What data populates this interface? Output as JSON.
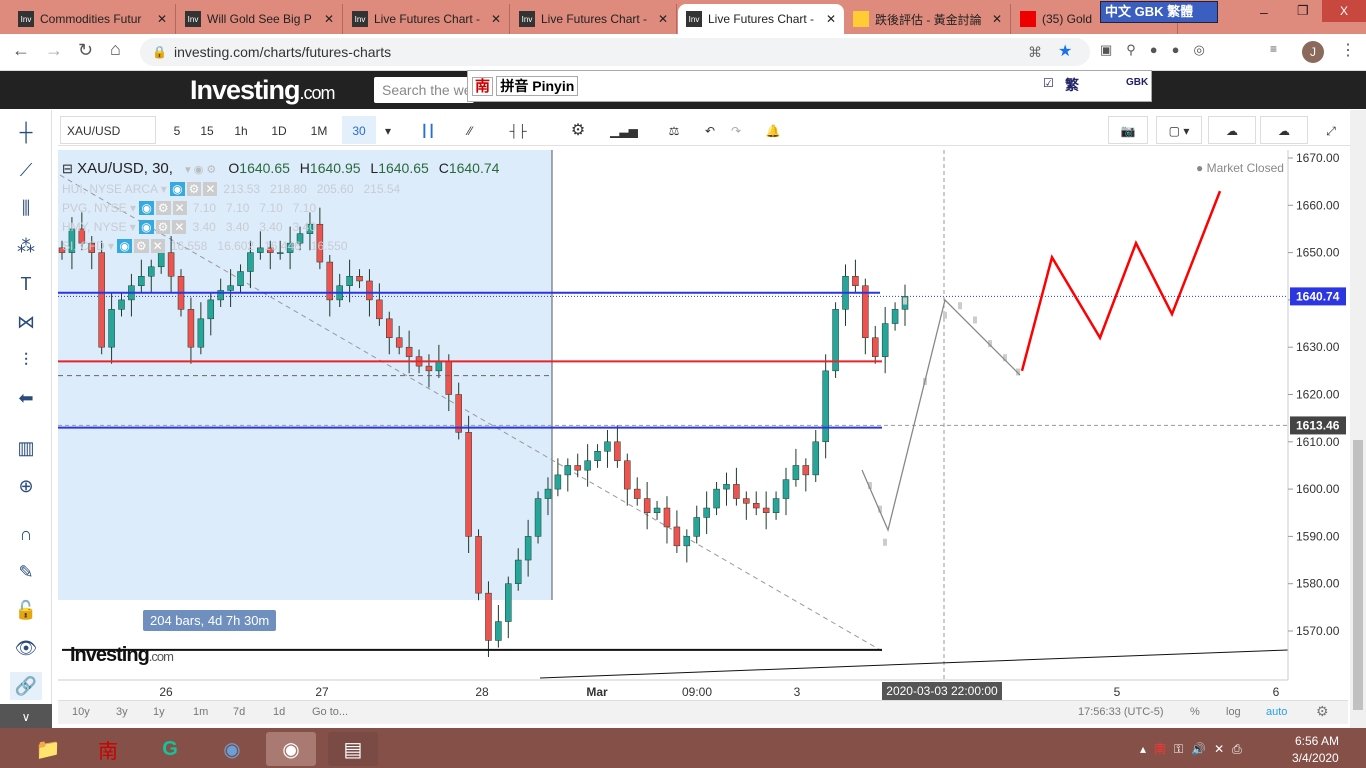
{
  "browser": {
    "tabs": [
      {
        "label": "Commodities Futur",
        "icon": "investing-icon"
      },
      {
        "label": "Will Gold See Big P",
        "icon": "investing-icon"
      },
      {
        "label": "Live Futures Chart -",
        "icon": "investing-icon"
      },
      {
        "label": "Live Futures Chart -",
        "icon": "investing-icon"
      },
      {
        "label": "Live Futures Chart -",
        "icon": "investing-icon",
        "active": true
      },
      {
        "label": "跌後評估 - 黃金討論",
        "icon": "bulb-icon"
      },
      {
        "label": "(35) Gold",
        "icon": "youtube-icon"
      }
    ],
    "url": "investing.com/charts/futures-charts",
    "profile": "J",
    "ime_lang": "中文 GBK 繁體"
  },
  "site": {
    "logo": "Investing",
    "logo_suffix": ".com",
    "search_placeholder": "Search the we"
  },
  "ime": {
    "mode": "拼音 Pinyin",
    "badge": "南",
    "trad": "繁",
    "gbk": "GBK"
  },
  "toolbar": {
    "symbol": "XAU/USD",
    "intervals": [
      "5",
      "15",
      "1h",
      "1D",
      "1M",
      "30"
    ],
    "active_interval": "30"
  },
  "legend": {
    "title": "XAU/USD, 30,",
    "o_label": "O",
    "o": "1640.65",
    "h_label": "H",
    "h": "1640.95",
    "l_label": "L",
    "l": "1640.65",
    "c_label": "C",
    "c": "1640.74",
    "studies": [
      {
        "name": "HUI, NYSE ARCA",
        "values": "213.53   218.80   205.60   215.54"
      },
      {
        "name": "PVG, NYSE",
        "values": "7.10   7.10   7.10   7.10"
      },
      {
        "name": "HMY, NYSE",
        "values": "3.40   3.40   3.40   3.40"
      },
      {
        "name": "SI, CFD",
        "values": "16.558   16.602   16.446   16.550"
      }
    ]
  },
  "chart_data": {
    "type": "candlestick",
    "symbol": "XAU/USD",
    "interval": "30",
    "ylim": [
      1565,
      1672
    ],
    "y_ticks": [
      1670,
      1660,
      1650,
      1640,
      1630,
      1620,
      1610,
      1600,
      1590,
      1580,
      1570
    ],
    "x_ticks": [
      "26",
      "27",
      "28",
      "Mar",
      "09:00",
      "3",
      "5",
      "6"
    ],
    "closes": [
      1650,
      1655,
      1652,
      1650,
      1630,
      1638,
      1640,
      1643,
      1645,
      1647,
      1650,
      1645,
      1638,
      1630,
      1636,
      1640,
      1642,
      1643,
      1646,
      1650,
      1651,
      1650,
      1650,
      1652,
      1654,
      1656,
      1648,
      1640,
      1643,
      1645,
      1644,
      1640,
      1636,
      1632,
      1630,
      1628,
      1626,
      1625,
      1627,
      1620,
      1612,
      1590,
      1578,
      1568,
      1572,
      1580,
      1585,
      1590,
      1598,
      1600,
      1603,
      1605,
      1604,
      1606,
      1608,
      1610,
      1606,
      1600,
      1598,
      1595,
      1596,
      1592,
      1588,
      1590,
      1594,
      1596,
      1600,
      1601,
      1598,
      1597,
      1596,
      1595,
      1598,
      1602,
      1605,
      1603,
      1610,
      1625,
      1638,
      1645,
      1643,
      1632,
      1628,
      1635,
      1638,
      1640.74
    ],
    "last_price": "1640.74",
    "crosshair_price": "1613.46",
    "crosshair_time": "2020-03-03 22:00:00",
    "status": "Market Closed",
    "range_label": "204 bars, 4d 7h 30m",
    "drawings": {
      "blue_lines": [
        1641.5,
        1613
      ],
      "red_line": 1627,
      "dashed_line": 1624,
      "support_line": 1566,
      "forecast_zigzag": [
        1625,
        1649,
        1632,
        1652,
        1637,
        1663
      ]
    },
    "colors": {
      "up": "#26a69a",
      "down": "#ef5350",
      "hline_blue": "#2b35e0",
      "hline_red": "#e8242a",
      "zigzag": "#ff0000",
      "selection": "#dcecfb"
    }
  },
  "bottom": {
    "ranges": [
      "10y",
      "3y",
      "1y",
      "1m",
      "7d",
      "1d",
      "Go to..."
    ],
    "clock": "17:56:33 (UTC-5)",
    "pct": "%",
    "log": "log",
    "auto": "auto"
  },
  "taskbar": {
    "time": "6:56 AM",
    "date": "3/4/2020"
  }
}
